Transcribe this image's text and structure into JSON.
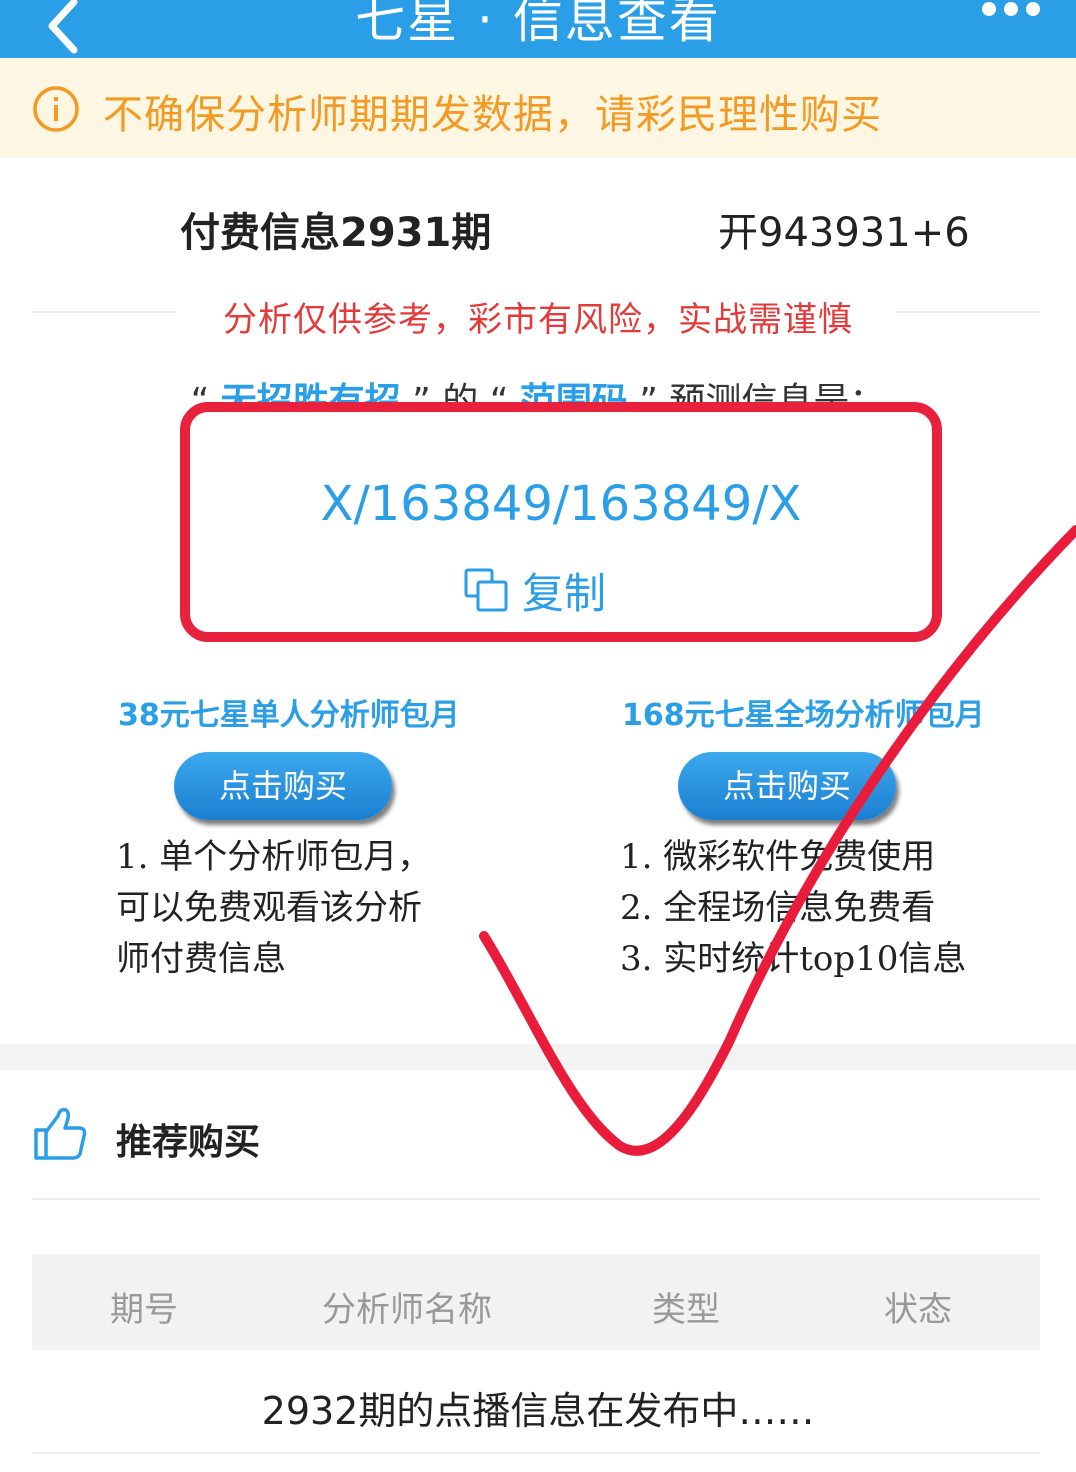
{
  "header": {
    "title": "七星 · 信息查看",
    "back_icon": "back-arrow-icon",
    "more_icon": "more-dots-icon"
  },
  "notice": {
    "icon": "info-circle-icon",
    "text": "不确保分析师期期发数据，请彩民理性购买",
    "color": "#f39a22"
  },
  "info": {
    "issue": "付费信息2931期",
    "draw": "开943931+6"
  },
  "risk_warning": "分析仅供参考，彩市有风险，实战需谨慎",
  "prediction": {
    "quote_open": "“",
    "quote_close": "”",
    "analyst": "无招胜有招",
    "connector": "的",
    "type": "范围码",
    "suffix": "预测信息是：",
    "code": "X/163849/163849/X",
    "copy_label": "复制",
    "copy_icon": "copy-icon"
  },
  "plans": [
    {
      "title": "38元七星单人分析师包月",
      "button": "点击购买",
      "desc": [
        "1. 单个分析师包月，",
        "可以免费观看该分析",
        "师付费信息"
      ]
    },
    {
      "title": "168元七星全场分析师包月",
      "button": "点击购买",
      "desc": [
        "1. 微彩软件免费使用",
        "2. 全程场信息免费看",
        "3. 实时统计top10信息"
      ]
    }
  ],
  "recommend": {
    "icon": "thumbs-up-icon",
    "title": "推荐购买",
    "columns": [
      "期号",
      "分析师名称",
      "类型",
      "状态"
    ],
    "message": "2932期的点播信息在发布中……"
  },
  "colors": {
    "header_bg": "#2a9ee6",
    "highlight": "#e8223d",
    "warning_text": "#e43a3a"
  }
}
